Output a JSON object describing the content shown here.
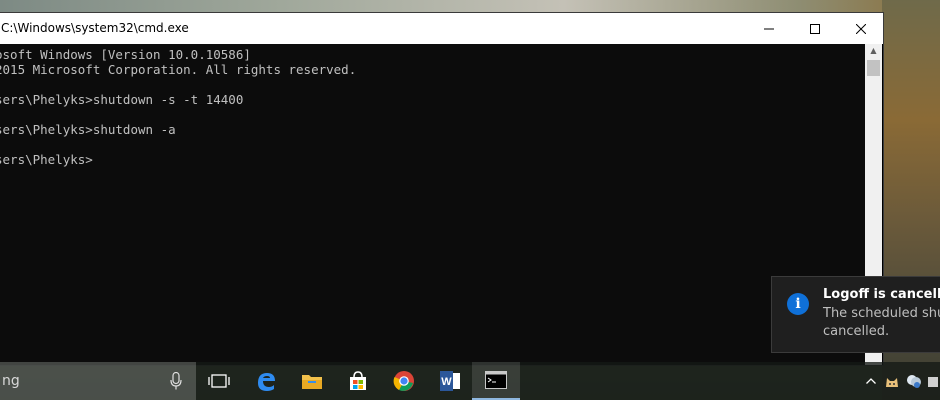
{
  "window": {
    "title": "C:\\Windows\\system32\\cmd.exe",
    "minimize": "—",
    "maximize": "☐",
    "close": "✕"
  },
  "console": {
    "lines": [
      "osoft Windows [Version 10.0.10586]",
      "2015 Microsoft Corporation. All rights reserved.",
      "",
      "sers\\Phelyks>shutdown -s -t 14400",
      "",
      "sers\\Phelyks>shutdown -a",
      "",
      "sers\\Phelyks>"
    ]
  },
  "toast": {
    "title": "Logoff is cancelled",
    "body_line1": "The scheduled shutdown",
    "body_line2": "cancelled.",
    "icon": "info-icon"
  },
  "taskbar": {
    "search_text": "ng",
    "apps": [
      {
        "name": "task-view",
        "icon": "task-view-icon"
      },
      {
        "name": "edge",
        "icon": "edge-icon"
      },
      {
        "name": "file-explorer",
        "icon": "folder-icon"
      },
      {
        "name": "store",
        "icon": "store-icon"
      },
      {
        "name": "chrome",
        "icon": "chrome-icon"
      },
      {
        "name": "word",
        "icon": "word-icon"
      },
      {
        "name": "cmd",
        "icon": "cmd-icon"
      }
    ],
    "tray_chevron": "^",
    "accent": "#0f70d8"
  }
}
